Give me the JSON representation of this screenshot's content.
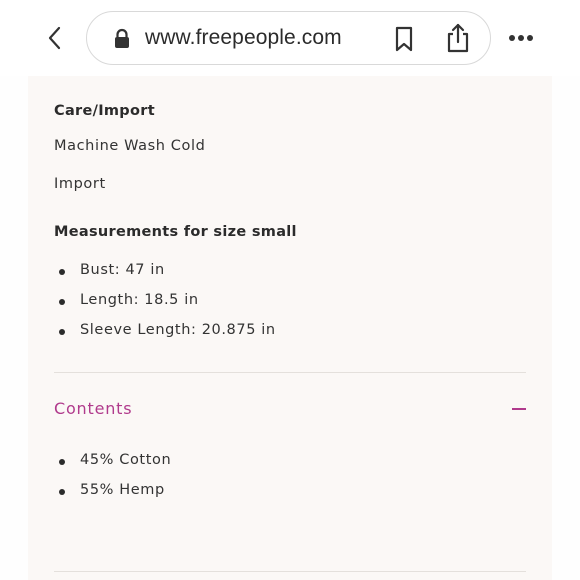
{
  "browser": {
    "url": "www.freepeople.com"
  },
  "care": {
    "heading": "Care/Import",
    "lines": [
      "Machine Wash Cold",
      "Import"
    ]
  },
  "measurements": {
    "heading": "Measurements for size small",
    "items": [
      "Bust: 47 in",
      "Length: 18.5 in",
      "Sleeve Length: 20.875 in"
    ]
  },
  "contents": {
    "title": "Contents",
    "expanded": true,
    "items": [
      "45% Cotton",
      "55% Hemp"
    ]
  },
  "colors": {
    "accent": "#b03a8c",
    "text": "#2b2b2b",
    "background": "#fbf8f6"
  },
  "icons": [
    "chevron-left-icon",
    "lock-icon",
    "bookmark-icon",
    "share-icon",
    "more-icon",
    "minus-icon"
  ]
}
